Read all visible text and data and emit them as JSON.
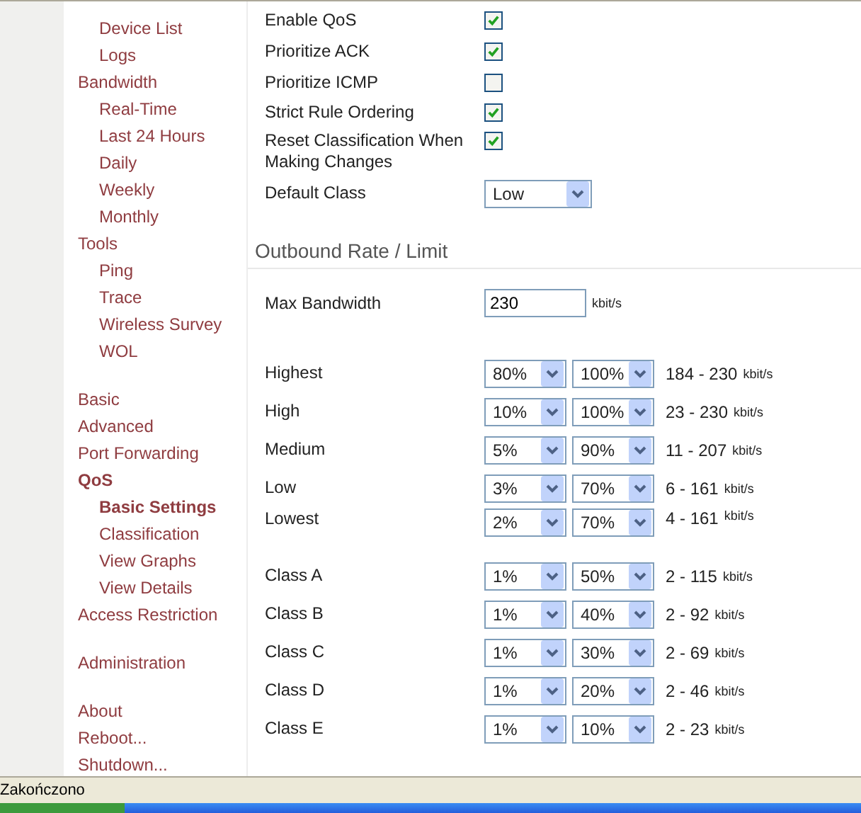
{
  "sidebar": {
    "sections": [
      {
        "items": [
          {
            "label": "Device List",
            "kind": "child",
            "selected": false
          },
          {
            "label": "Logs",
            "kind": "child",
            "selected": false
          },
          {
            "label": "Bandwidth",
            "kind": "parent",
            "selected": false,
            "children": [
              {
                "label": "Real-Time",
                "selected": false
              },
              {
                "label": "Last 24 Hours",
                "selected": false
              },
              {
                "label": "Daily",
                "selected": false
              },
              {
                "label": "Weekly",
                "selected": false
              },
              {
                "label": "Monthly",
                "selected": false
              }
            ]
          },
          {
            "label": "Tools",
            "kind": "parent",
            "selected": false,
            "children": [
              {
                "label": "Ping",
                "selected": false
              },
              {
                "label": "Trace",
                "selected": false
              },
              {
                "label": "Wireless Survey",
                "selected": false
              },
              {
                "label": "WOL",
                "selected": false
              }
            ]
          }
        ]
      },
      {
        "items": [
          {
            "label": "Basic",
            "kind": "parent",
            "selected": false
          },
          {
            "label": "Advanced",
            "kind": "parent",
            "selected": false
          },
          {
            "label": "Port Forwarding",
            "kind": "parent",
            "selected": false
          },
          {
            "label": "QoS",
            "kind": "parent",
            "selected": true,
            "children": [
              {
                "label": "Basic Settings",
                "selected": true
              },
              {
                "label": "Classification",
                "selected": false
              },
              {
                "label": "View Graphs",
                "selected": false
              },
              {
                "label": "View Details",
                "selected": false
              }
            ]
          },
          {
            "label": "Access Restriction",
            "kind": "parent",
            "selected": false
          }
        ]
      },
      {
        "items": [
          {
            "label": "Administration",
            "kind": "parent",
            "selected": false
          }
        ]
      },
      {
        "items": [
          {
            "label": "About",
            "kind": "parent",
            "selected": false
          },
          {
            "label": "Reboot...",
            "kind": "parent",
            "selected": false
          },
          {
            "label": "Shutdown...",
            "kind": "parent",
            "selected": false
          }
        ]
      }
    ]
  },
  "settings": [
    {
      "label": "Enable QoS",
      "kind": "checkbox",
      "checked": true
    },
    {
      "label": "Prioritize ACK",
      "kind": "checkbox",
      "checked": true
    },
    {
      "label": "Prioritize ICMP",
      "kind": "checkbox",
      "checked": false
    },
    {
      "label": "Strict Rule Ordering",
      "kind": "checkbox",
      "checked": true
    },
    {
      "label": "Reset Classification When Making Changes",
      "kind": "checkbox",
      "checked": true
    },
    {
      "label": "Default Class",
      "kind": "select",
      "value": "Low"
    }
  ],
  "outbound": {
    "title": "Outbound Rate / Limit",
    "max_bandwidth": {
      "label": "Max Bandwidth",
      "value": "230",
      "unit": "kbit/s"
    },
    "classes": [
      {
        "name": "Highest",
        "rate": "80%",
        "limit": "100%",
        "range": "184 - 230",
        "unit": "kbit/s"
      },
      {
        "name": "High",
        "rate": "10%",
        "limit": "100%",
        "range": "23 - 230",
        "unit": "kbit/s"
      },
      {
        "name": "Medium",
        "rate": "5%",
        "limit": "90%",
        "range": "11 - 207",
        "unit": "kbit/s"
      },
      {
        "name": "Low",
        "rate": "3%",
        "limit": "70%",
        "range": "6 - 161",
        "unit": "kbit/s"
      },
      {
        "name": "Lowest",
        "rate": "2%",
        "limit": "70%",
        "range": "4 - 161",
        "unit": "kbit/s"
      },
      {
        "name": "Class A",
        "rate": "1%",
        "limit": "50%",
        "range": "2 - 115",
        "unit": "kbit/s"
      },
      {
        "name": "Class B",
        "rate": "1%",
        "limit": "40%",
        "range": "2 - 92",
        "unit": "kbit/s"
      },
      {
        "name": "Class C",
        "rate": "1%",
        "limit": "30%",
        "range": "2 - 69",
        "unit": "kbit/s"
      },
      {
        "name": "Class D",
        "rate": "1%",
        "limit": "20%",
        "range": "2 - 46",
        "unit": "kbit/s"
      },
      {
        "name": "Class E",
        "rate": "1%",
        "limit": "10%",
        "range": "2 - 23",
        "unit": "kbit/s"
      }
    ]
  },
  "status_bar": {
    "text": "Zakończono"
  }
}
